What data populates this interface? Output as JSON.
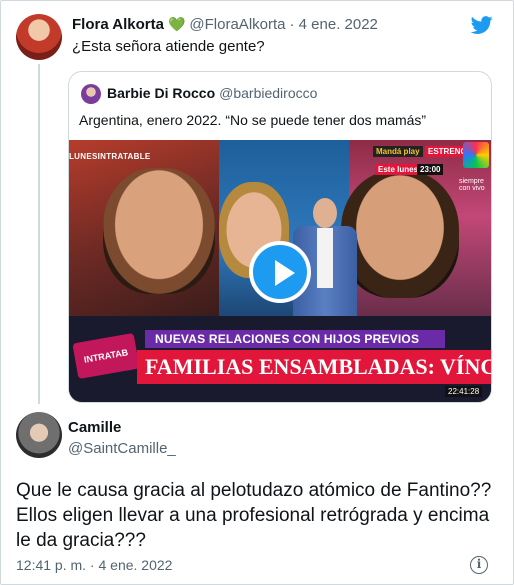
{
  "top_tweet": {
    "name": "Flora Alkorta",
    "badge": "💚",
    "handle": "@FloraAlkorta",
    "date": "· 4 ene. 2022",
    "text": "¿Esta señora atiende gente?"
  },
  "quoted_tweet": {
    "name": "Barbie Di Rocco",
    "handle": "@barbiedirocco",
    "text": "Argentina, enero 2022. “No se puede tener dos mamás”",
    "video": {
      "tag_show": "LUNESINTRATABLE",
      "tag_manda": "Mandá play",
      "tag_estreno": "ESTRENO",
      "tag_este_lunes": "Este lunes",
      "tag_hora": "23:00",
      "tag_vivo": "siempre con vivo",
      "lower_third_top": "NUEVAS RELACIONES CON HIJOS PREVIOS",
      "lower_third_main": "FAMILIAS ENSAMBLADAS: VÍNCULOS Y CONFLICTOS",
      "logo": "INTRATAB",
      "timecode": "22:41:28"
    }
  },
  "reply": {
    "name": "Camille",
    "handle": "@SaintCamille_",
    "text": "Que le causa gracia al pelotudazo atómico de Fantino?? Ellos eligen llevar a una profesional retrógrada y encima le da gracia???",
    "timestamp": "12:41 p. m. · 4 ene. 2022"
  },
  "icons": {
    "brand": "twitter-bird-icon",
    "play": "play-icon",
    "info": "info-icon"
  },
  "colors": {
    "accent": "#1d9bf0",
    "text": "#0f1419",
    "muted": "#536471",
    "border": "#cfd9de"
  }
}
